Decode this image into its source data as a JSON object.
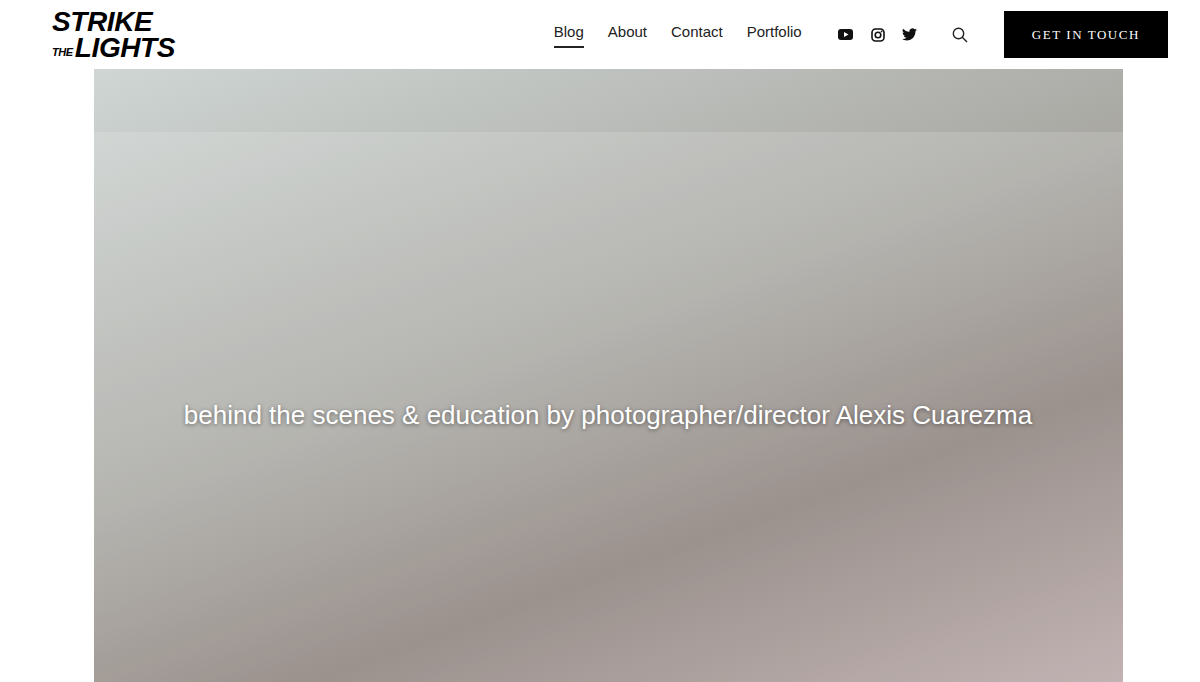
{
  "logo": {
    "lines": [
      "STRIKE",
      "THE",
      "LIGHTS"
    ]
  },
  "nav": [
    {
      "label": "Blog",
      "selected": true
    },
    {
      "label": "About",
      "selected": false
    },
    {
      "label": "Contact",
      "selected": false
    },
    {
      "label": "Portfolio",
      "selected": false
    }
  ],
  "cta": "GET IN TOUCH",
  "hero": {
    "caption": "behind the scenes & education by photographer/director Alexis Cuarezma"
  }
}
